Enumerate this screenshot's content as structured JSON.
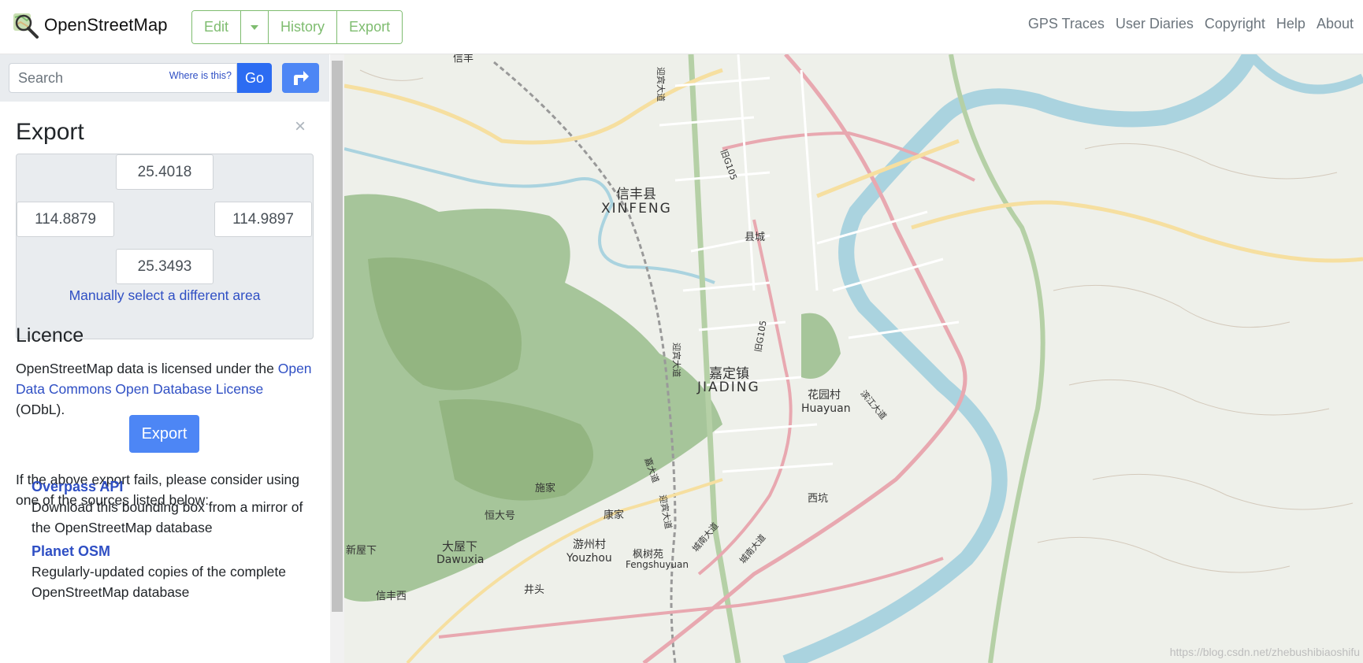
{
  "header": {
    "brand": "OpenStreetMap",
    "edit": "Edit",
    "history": "History",
    "export": "Export",
    "nav": [
      "GPS Traces",
      "User Diaries",
      "Copyright",
      "Help",
      "About"
    ]
  },
  "search": {
    "placeholder": "Search",
    "where_link": "Where is this?",
    "go": "Go"
  },
  "export_panel": {
    "title": "Export",
    "close": "×",
    "bbox": {
      "north": "25.4018",
      "west": "114.8879",
      "east": "114.9897",
      "south": "25.3493"
    },
    "manual_link": "Manually select a different area",
    "licence_title": "Licence",
    "licence_pre": "OpenStreetMap data is licensed under the ",
    "licence_link": "Open Data Commons Open Database License",
    "licence_post": " (ODbL).",
    "export_button": "Export",
    "fail_text": "If the above export fails, please consider using one of the sources listed below:",
    "sources": [
      {
        "title": "Overpass API",
        "desc": "Download this bounding box from a mirror of the OpenStreetMap database"
      },
      {
        "title": "Planet OSM",
        "desc": "Regularly-updated copies of the complete OpenStreetMap database"
      }
    ]
  },
  "map": {
    "labels": {
      "xinfeng_cn": "信丰县",
      "xinfeng_en": "XINFENG",
      "jiading_cn": "嘉定镇",
      "jiading_en": "JIADING",
      "huayuan_cn": "花园村",
      "huayuan_en": "Huayuan",
      "dawuxia_cn": "大屋下",
      "dawuxia_en": "Dawuxia",
      "youzhou_cn": "游州村",
      "youzhou_en": "Youzhou",
      "fengshuyuan_cn": "枫树苑",
      "fengshuyuan_en": "Fengshuyuan",
      "xinfeng_top": "信丰",
      "xiancheng": "县城",
      "shijia": "施家",
      "hengdahao": "恒大号",
      "kangjia": "康家",
      "xinwuxia": "新屋下",
      "xikeng": "西坑",
      "jingtou": "井头",
      "xinfengxi": "信丰西",
      "g105_a": "旧G105",
      "g105_b": "旧G105",
      "yingbin_a": "迎宾大道",
      "yingbin_b": "迎宾大道",
      "yingbin_c": "迎宾大道",
      "chengnan_a": "城南大道",
      "chengnan_b": "城南大道",
      "jiangnan": "滨江大道",
      "kuaiji": "嘉大道"
    },
    "colors": {
      "water": "#aad3df",
      "forest": "#8fb07a",
      "road_major": "#e8a8b0",
      "road_trunk": "#b5d0a6",
      "road_secondary": "#f6dfa0"
    },
    "watermark": "https://blog.csdn.net/zhebushibiaoshifu"
  }
}
